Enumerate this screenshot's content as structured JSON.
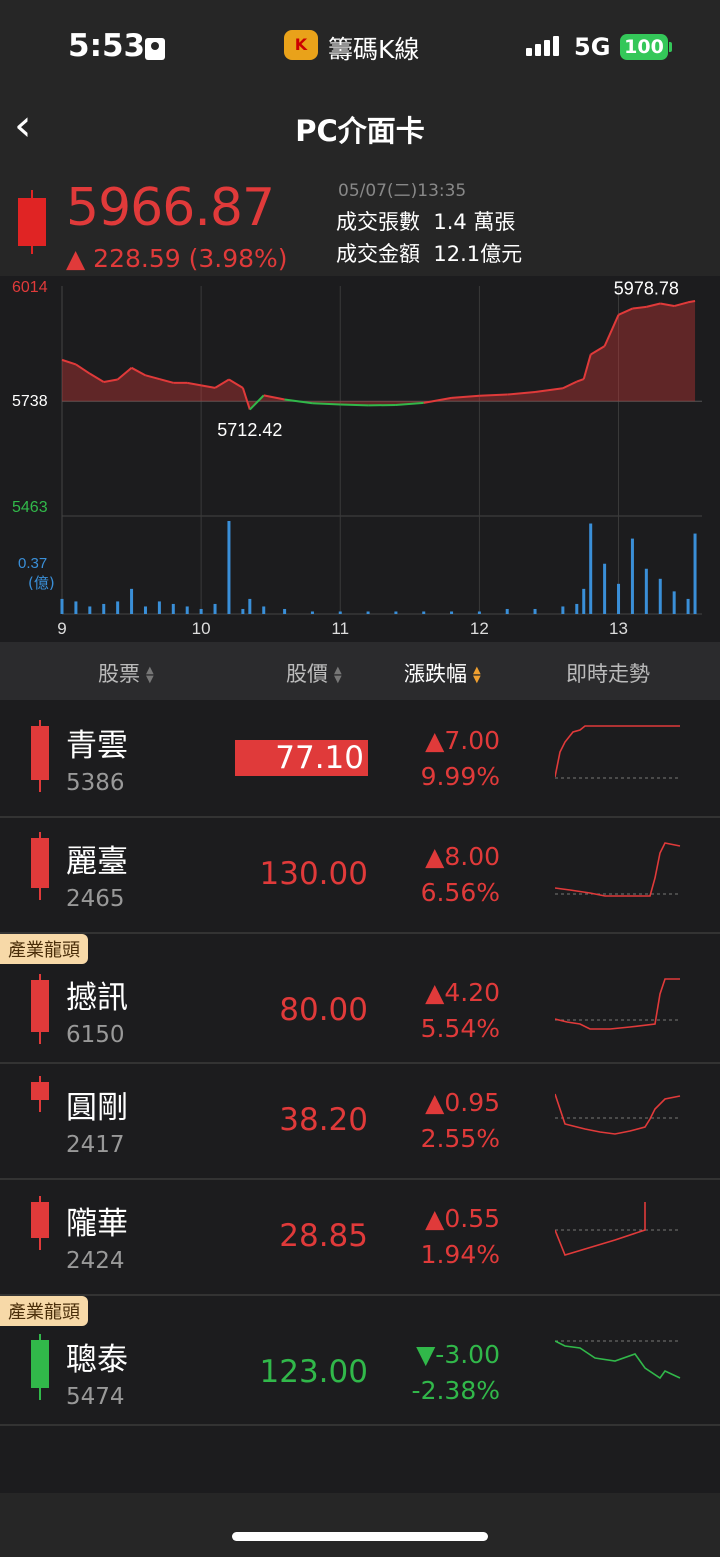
{
  "status": {
    "time": "5:53",
    "network": "5G",
    "battery": "100",
    "app_name": "籌碼K線",
    "app_logo": "K"
  },
  "nav": {
    "back_icon": "‹",
    "title": "PC介面卡"
  },
  "quote": {
    "price": "5966.87",
    "change": "▲ 228.59 (3.98%)",
    "timestamp": "05/07(二)13:35",
    "volume_label": "成交張數",
    "volume_value": "1.4 萬張",
    "amount_label": "成交金額",
    "amount_value": "12.1億元"
  },
  "chart_data": {
    "type": "line",
    "x_ticks": [
      "9",
      "10",
      "11",
      "12",
      "13"
    ],
    "y_ticks": [
      "6014",
      "5738",
      "5463"
    ],
    "reference": 5738,
    "high_label": "5978.78",
    "low_label": "5712.42",
    "volume_axis_label": "0.37",
    "volume_unit": "(億)",
    "x": [
      9.0,
      9.1,
      9.2,
      9.3,
      9.4,
      9.5,
      9.6,
      9.7,
      9.8,
      9.9,
      10.0,
      10.1,
      10.2,
      10.3,
      10.35,
      10.45,
      10.6,
      10.8,
      11.0,
      11.2,
      11.4,
      11.6,
      11.8,
      12.0,
      12.2,
      12.4,
      12.6,
      12.7,
      12.75,
      12.8,
      12.9,
      13.0,
      13.1,
      13.2,
      13.3,
      13.4,
      13.5,
      13.55
    ],
    "y": [
      5837,
      5826,
      5804,
      5784,
      5790,
      5818,
      5800,
      5791,
      5782,
      5782,
      5776,
      5770,
      5790,
      5770,
      5718,
      5752,
      5742,
      5733,
      5730,
      5728,
      5729,
      5734,
      5746,
      5751,
      5754,
      5760,
      5769,
      5785,
      5791,
      5850,
      5870,
      5945,
      5960,
      5964,
      5972,
      5966,
      5975,
      5978
    ],
    "volume": [
      0.06,
      0.05,
      0.03,
      0.04,
      0.05,
      0.1,
      0.03,
      0.05,
      0.04,
      0.03,
      0.02,
      0.04,
      0.37,
      0.02,
      0.06,
      0.03,
      0.02,
      0.01,
      0.01,
      0.01,
      0.01,
      0.01,
      0.01,
      0.01,
      0.02,
      0.02,
      0.03,
      0.04,
      0.1,
      0.36,
      0.2,
      0.12,
      0.3,
      0.18,
      0.14,
      0.09,
      0.06,
      0.32
    ]
  },
  "table": {
    "headers": [
      "股票",
      "股價",
      "漲跌幅",
      "即時走勢"
    ],
    "tag_label": "產業龍頭",
    "rows": [
      {
        "name": "青雲",
        "code": "5386",
        "price": "77.10",
        "change": "▲7.00",
        "pct": "9.99%",
        "dir": "up"
      },
      {
        "name": "麗臺",
        "code": "2465",
        "price": "130.00",
        "change": "▲8.00",
        "pct": "6.56%",
        "dir": "up"
      },
      {
        "name": "撼訊",
        "code": "6150",
        "price": "80.00",
        "change": "▲4.20",
        "pct": "5.54%",
        "dir": "up",
        "tag": true
      },
      {
        "name": "圓剛",
        "code": "2417",
        "price": "38.20",
        "change": "▲0.95",
        "pct": "2.55%",
        "dir": "up"
      },
      {
        "name": "隴華",
        "code": "2424",
        "price": "28.85",
        "change": "▲0.55",
        "pct": "1.94%",
        "dir": "up"
      },
      {
        "name": "聰泰",
        "code": "5474",
        "price": "123.00",
        "change": "▼-3.00",
        "pct": "-2.38%",
        "dir": "down",
        "tag": true
      }
    ]
  },
  "colors": {
    "up": "#e03a3a",
    "down": "#31b84a",
    "volume": "#3a8fd8",
    "accent": "#f0a030"
  }
}
